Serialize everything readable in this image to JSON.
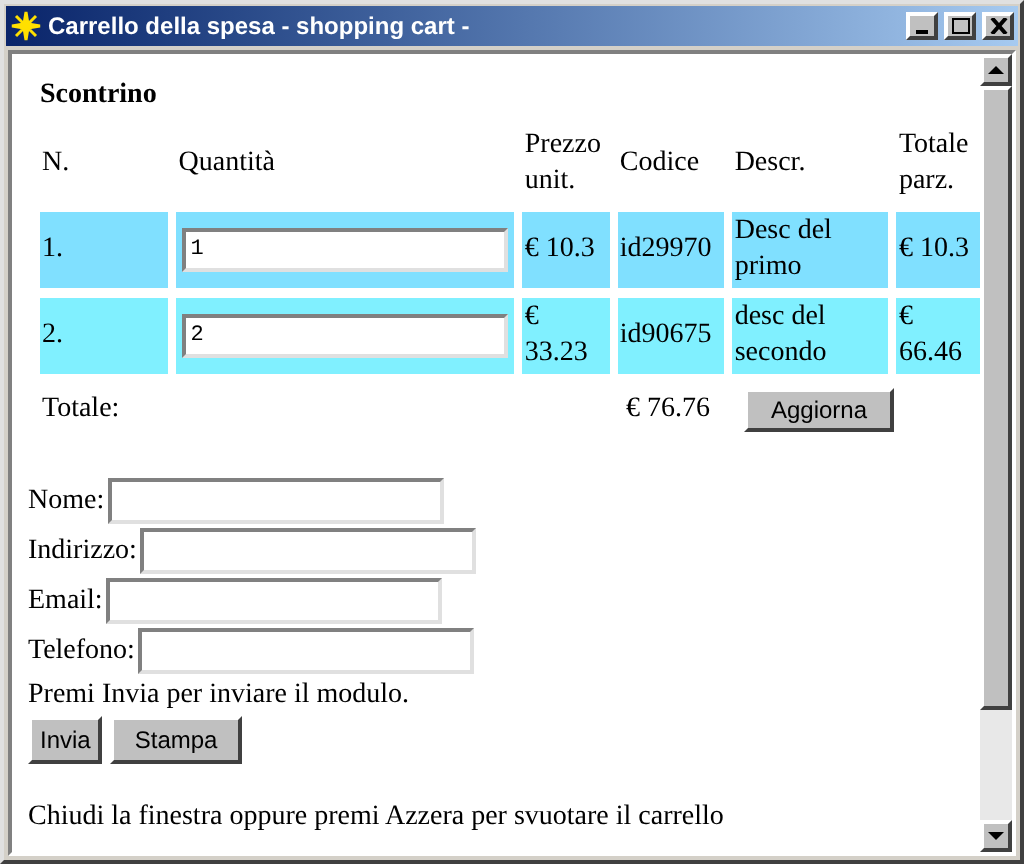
{
  "window": {
    "title": "Carrello della spesa - shopping cart -"
  },
  "cart": {
    "title": "Scontrino",
    "columns": [
      "N.",
      "Quantità",
      "Prezzo unit.",
      "Codice",
      "Descr.",
      "Totale parz."
    ],
    "rows": [
      {
        "n": "1.",
        "quantity": "1",
        "price": "€ 10.3",
        "code": "id29970",
        "description": "Desc del primo",
        "subtotal": "€ 10.3",
        "color": "#80e0ff"
      },
      {
        "n": "2.",
        "quantity": "2",
        "price": "€ 33.23",
        "code": "id90675",
        "description": "desc del secondo",
        "subtotal": "€ 66.46",
        "color": "#80f0ff"
      }
    ],
    "total_label": "Totale:",
    "total": "€ 76.76",
    "update_button": "Aggiorna"
  },
  "form": {
    "fields": [
      {
        "label": "Nome:"
      },
      {
        "label": "Indirizzo:"
      },
      {
        "label": "Email:"
      },
      {
        "label": "Telefono:"
      }
    ],
    "hint": "Premi Invia per inviare il modulo.",
    "buttons": [
      "Invia",
      "Stampa"
    ],
    "footer": "Chiudi la finestra oppure premi Azzera per svuotare il carrello"
  }
}
